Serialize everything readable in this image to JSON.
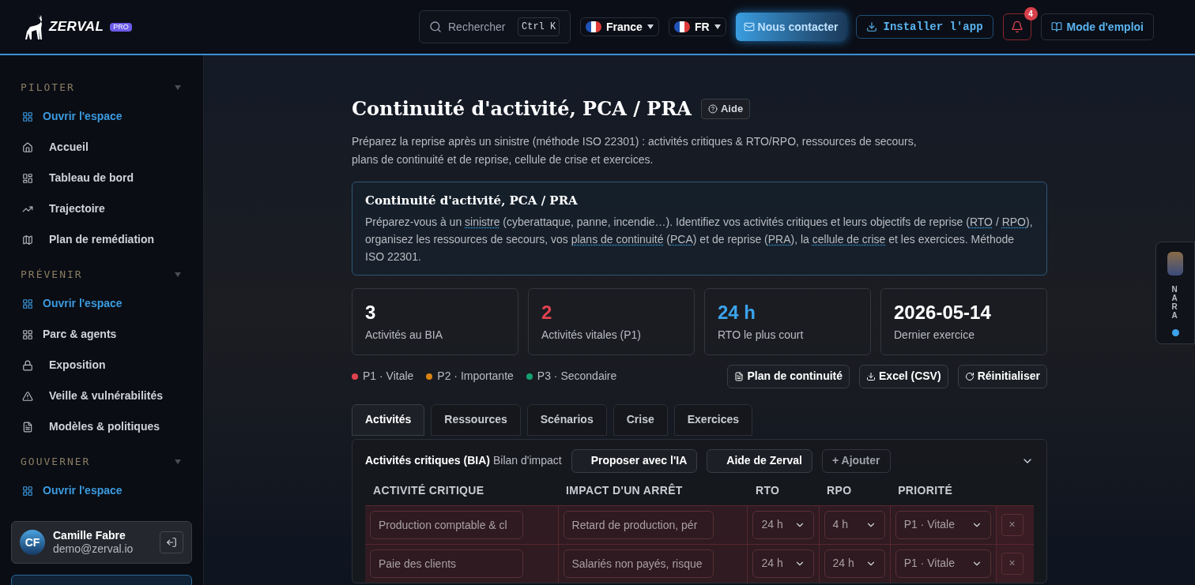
{
  "header": {
    "logo": "ZERVAL",
    "logo_badge": "PRO",
    "search": {
      "placeholder": "Rechercher",
      "shortcut": "Ctrl K"
    },
    "country": "France",
    "language": "FR",
    "contact": "Nous contacter",
    "install": "Installer l'app",
    "notifications": "4",
    "guide": "Mode d'emploi"
  },
  "sidebar": {
    "sections": [
      {
        "title": "PILOTER",
        "expanded": true,
        "items": [
          {
            "kind": "space",
            "label": "Ouvrir l'espace"
          },
          {
            "kind": "page",
            "label": "Accueil"
          },
          {
            "kind": "page",
            "label": "Tableau de bord"
          },
          {
            "kind": "page",
            "label": "Trajectoire"
          },
          {
            "kind": "page",
            "label": "Plan de remédiation"
          }
        ]
      },
      {
        "title": "PRÉVENIR",
        "expanded": true,
        "items": [
          {
            "kind": "space",
            "label": "Ouvrir l'espace"
          },
          {
            "kind": "group",
            "label": "Parc & agents"
          },
          {
            "kind": "page",
            "label": "Exposition"
          },
          {
            "kind": "page",
            "label": "Veille & vulnérabilités"
          },
          {
            "kind": "page",
            "label": "Modèles & politiques"
          }
        ]
      },
      {
        "title": "GOUVERNER",
        "expanded": true,
        "items": [
          {
            "kind": "space",
            "label": "Ouvrir l'espace"
          }
        ]
      }
    ],
    "user": {
      "initials": "CF",
      "name": "Camille Fabre",
      "email": "demo@zerval.io"
    }
  },
  "page": {
    "title": "Continuité d'activité, PCA / PRA",
    "help": "Aide",
    "subtitle": "Préparez la reprise après un sinistre (méthode ISO 22301) : activités critiques & RTO/RPO, ressources de secours, plans de continuité et de reprise, cellule de crise et exercices.",
    "intro": {
      "title": "Continuité d'activité, PCA / PRA",
      "segments": [
        {
          "kind": "text",
          "text": "Préparez-vous à un "
        },
        {
          "kind": "link",
          "text": "sinistre"
        },
        {
          "kind": "text",
          "text": " (cyberattaque, panne, incendie…). Identifiez vos activités critiques et leurs objectifs de reprise ("
        },
        {
          "kind": "link",
          "text": "RTO"
        },
        {
          "kind": "text",
          "text": " / "
        },
        {
          "kind": "link",
          "text": "RPO"
        },
        {
          "kind": "text",
          "text": "), organisez les ressources de secours, vos "
        },
        {
          "kind": "link",
          "text": "plans de continuité"
        },
        {
          "kind": "text",
          "text": " ("
        },
        {
          "kind": "link",
          "text": "PCA"
        },
        {
          "kind": "text",
          "text": ") et de reprise ("
        },
        {
          "kind": "link",
          "text": "PRA"
        },
        {
          "kind": "text",
          "text": "), la "
        },
        {
          "kind": "link",
          "text": "cellule de crise"
        },
        {
          "kind": "text",
          "text": " et les exercices. Méthode ISO 22301."
        }
      ]
    },
    "stats": [
      {
        "value": "3",
        "label": "Activités au BIA",
        "color": "#ffffff"
      },
      {
        "value": "2",
        "label": "Activités vitales (P1)",
        "color": "#e0424f"
      },
      {
        "value": "24 h",
        "label": "RTO le plus court",
        "color": "#3ba3ec"
      },
      {
        "value": "2026-05-14",
        "label": "Dernier exercice",
        "color": "#ffffff"
      }
    ],
    "legend": [
      {
        "label": "P1 · Vitale",
        "color": "#e0424f"
      },
      {
        "label": "P2 · Importante",
        "color": "#d9820f"
      },
      {
        "label": "P3 · Secondaire",
        "color": "#16a072"
      }
    ],
    "actions": [
      "Plan de continuité",
      "Excel (CSV)",
      "Réinitialiser"
    ],
    "tabs": [
      {
        "label": "Activités",
        "selected": true
      },
      {
        "label": "Ressources",
        "selected": false
      },
      {
        "label": "Scénarios",
        "selected": false
      },
      {
        "label": "Crise",
        "selected": false
      },
      {
        "label": "Exercices",
        "selected": false
      }
    ],
    "panel": {
      "title": "Activités critiques (BIA)",
      "subtitle": "Bilan d'impact",
      "buttons": [
        "Proposer avec l'IA",
        "Aide de Zerval"
      ],
      "add": "+ Ajouter",
      "expanded": true,
      "columns": [
        "ACTIVITÉ CRITIQUE",
        "IMPACT D'UN ARRÊT",
        "RTO",
        "RPO",
        "PRIORITÉ"
      ],
      "rows": [
        {
          "activity": "Production comptable & cl",
          "impact": "Retard de production, pér",
          "rto": "24 h",
          "rpo": "4 h",
          "priority": "P1 · Vitale",
          "delete": "×"
        },
        {
          "activity": "Paie des clients",
          "impact": "Salariés non payés, risque",
          "rto": "24 h",
          "rpo": "24 h",
          "priority": "P1 · Vitale",
          "delete": "×"
        }
      ]
    }
  },
  "assistant": {
    "label": "NARA",
    "online": true
  }
}
